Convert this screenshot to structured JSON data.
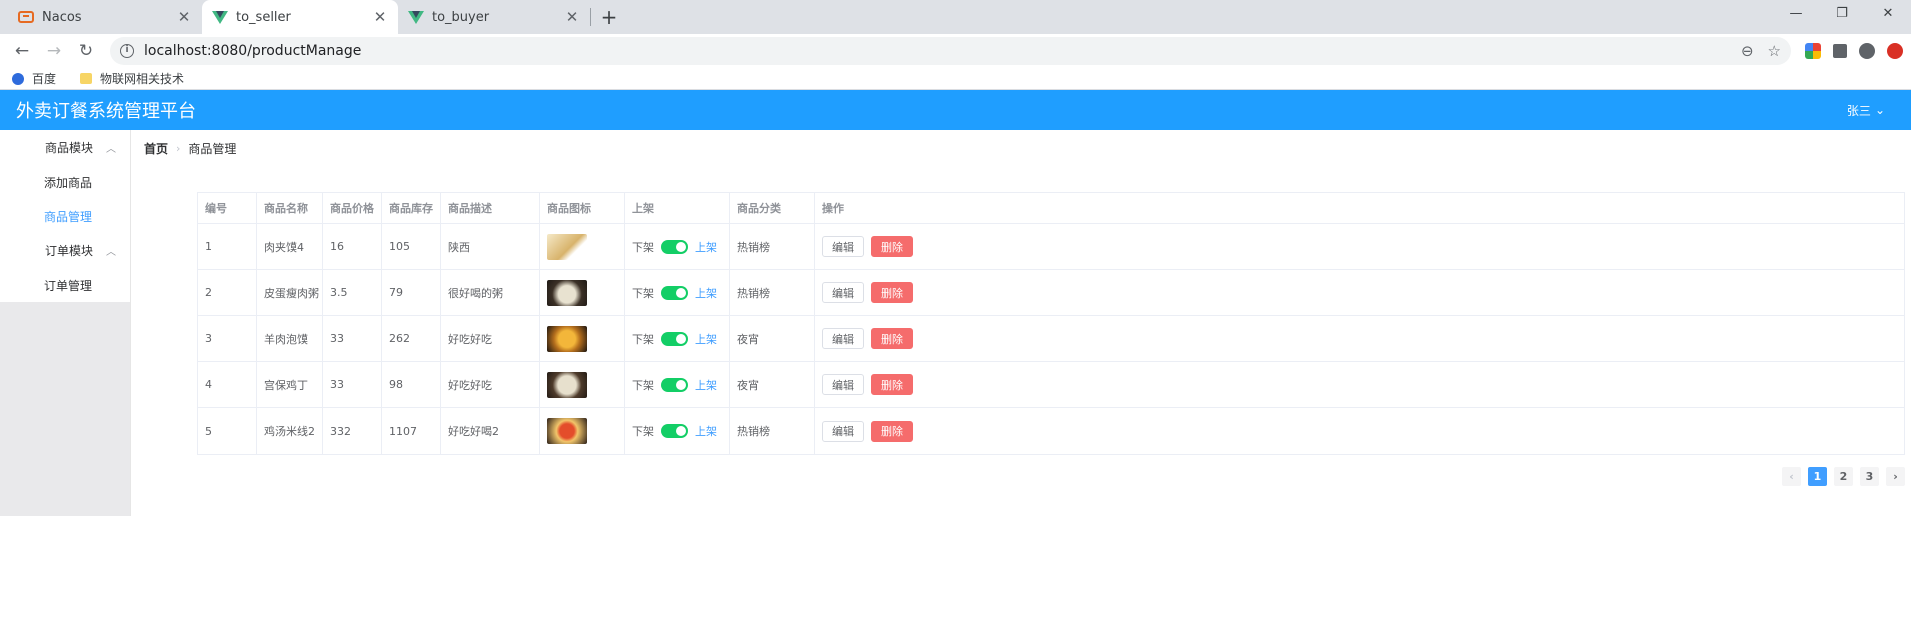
{
  "browser": {
    "tabs": [
      {
        "title": "Nacos",
        "icon": "nacos-icon"
      },
      {
        "title": "to_seller",
        "icon": "vue-icon"
      },
      {
        "title": "to_buyer",
        "icon": "vue-icon"
      }
    ],
    "url": "localhost:8080/productManage",
    "bookmarks": [
      {
        "label": "百度",
        "icon": "paw-icon"
      },
      {
        "label": "物联网相关技术",
        "icon": "folder-icon"
      }
    ]
  },
  "header": {
    "title": "外卖订餐系统管理平台",
    "user": "张三"
  },
  "sidebar": {
    "groups": [
      {
        "label": "商品模块",
        "items": [
          "添加商品",
          "商品管理"
        ]
      },
      {
        "label": "订单模块",
        "items": [
          "订单管理"
        ]
      }
    ],
    "active_item": "商品管理"
  },
  "breadcrumb": {
    "home": "首页",
    "current": "商品管理"
  },
  "table": {
    "columns": [
      "编号",
      "商品名称",
      "商品价格",
      "商品库存",
      "商品描述",
      "商品图标",
      "上架",
      "商品分类",
      "操作"
    ],
    "rows": [
      {
        "id": "1",
        "name": "肉夹馍4",
        "price": "16",
        "stock": "105",
        "desc": "陕西",
        "category": "热销榜"
      },
      {
        "id": "2",
        "name": "皮蛋瘦肉粥",
        "price": "3.5",
        "stock": "79",
        "desc": "很好喝的粥",
        "category": "热销榜"
      },
      {
        "id": "3",
        "name": "羊肉泡馍",
        "price": "33",
        "stock": "262",
        "desc": "好吃好吃",
        "category": "夜宵"
      },
      {
        "id": "4",
        "name": "宫保鸡丁",
        "price": "33",
        "stock": "98",
        "desc": "好吃好吃",
        "category": "夜宵"
      },
      {
        "id": "5",
        "name": "鸡汤米线2",
        "price": "332",
        "stock": "1107",
        "desc": "好吃好喝2",
        "category": "热销榜"
      }
    ],
    "switch_off_label": "下架",
    "switch_on_label": "上架",
    "edit_label": "编辑",
    "delete_label": "删除"
  },
  "pagination": {
    "pages": [
      "1",
      "2",
      "3"
    ],
    "current": "1",
    "prev": "‹",
    "next": "›"
  },
  "colors": {
    "header_bg": "#1f9eff",
    "accent": "#409eff",
    "switch_on": "#13ce66",
    "danger": "#f56c6c"
  }
}
